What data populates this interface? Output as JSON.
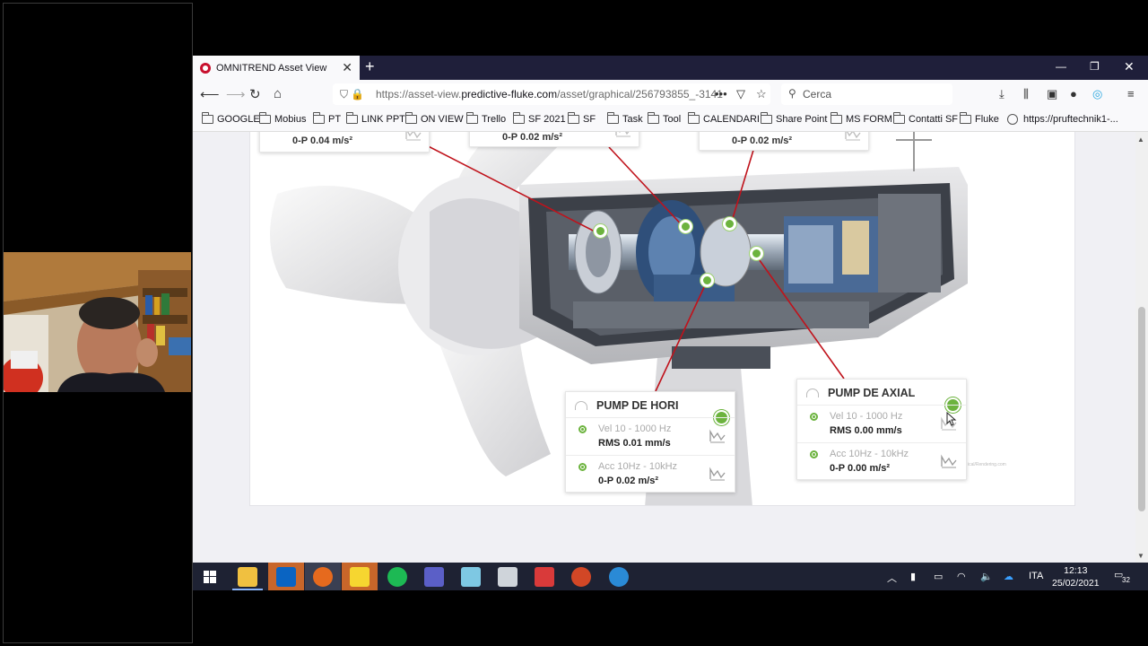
{
  "browser": {
    "tab_title": "OMNITREND Asset View",
    "url_prefix": "https://asset-view.",
    "url_domain": "predictive-fluke.com",
    "url_path": "/asset/graphical/256793855_-3141",
    "search_placeholder": "Cerca"
  },
  "bookmarks": [
    {
      "label": "GOOGLE",
      "icon": "folder-icon"
    },
    {
      "label": "Mobius",
      "icon": "folder-icon"
    },
    {
      "label": "PT",
      "icon": "folder-icon"
    },
    {
      "label": "LINK PPT",
      "icon": "folder-icon"
    },
    {
      "label": "ON VIEW",
      "icon": "folder-icon"
    },
    {
      "label": "Trello",
      "icon": "folder-icon"
    },
    {
      "label": "SF 2021",
      "icon": "folder-icon"
    },
    {
      "label": "SF",
      "icon": "folder-icon"
    },
    {
      "label": "Task",
      "icon": "folder-icon"
    },
    {
      "label": "Tool",
      "icon": "folder-icon"
    },
    {
      "label": "CALENDARI",
      "icon": "folder-icon"
    },
    {
      "label": "Share Point",
      "icon": "folder-icon"
    },
    {
      "label": "MS FORM",
      "icon": "folder-icon"
    },
    {
      "label": "Contatti SF",
      "icon": "folder-icon"
    },
    {
      "label": "Fluke",
      "icon": "folder-icon"
    },
    {
      "label": "https://pruftechnik1-...",
      "icon": "globe-icon"
    }
  ],
  "top_readings": [
    {
      "value": "0-P 0.04 m/s²"
    },
    {
      "value": "0-P 0.02 m/s²"
    },
    {
      "value": "0-P 0.02 m/s²"
    }
  ],
  "popups": [
    {
      "title": "PUMP DE HORI",
      "status_color": "#6cb33e",
      "rows": [
        {
          "label": "Vel 10 - 1000 Hz",
          "value": "RMS 0.01 mm/s"
        },
        {
          "label": "Acc 10Hz - 10kHz",
          "value": "0-P 0.02 m/s²"
        }
      ]
    },
    {
      "title": "PUMP DE AXIAL",
      "status_color": "#6cb33e",
      "rows": [
        {
          "label": "Vel 10 - 1000 Hz",
          "value": "RMS 0.00 mm/s"
        },
        {
          "label": "Acc 10Hz - 10kHz",
          "value": "0-P 0.00 m/s²"
        }
      ]
    }
  ],
  "taskbar": {
    "language": "ITA",
    "time": "12:13",
    "date": "25/02/2021",
    "notifications": "32"
  },
  "colors": {
    "status_ok": "#6cb33e",
    "leader_line": "#c0121b",
    "titlebar": "#1f1f3a",
    "taskbar": "#1e2233"
  }
}
